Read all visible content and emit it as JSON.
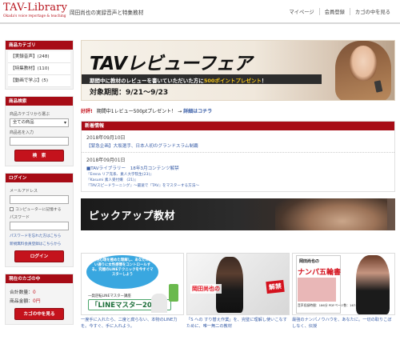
{
  "header": {
    "logo_main": "TAV-Library",
    "logo_sub": "Okada's voice reportage & teaching",
    "tagline": "岡田尚也の実録音声と特集教材",
    "nav": [
      "マイページ",
      "会員登録",
      "カゴの中を見る"
    ]
  },
  "sidebar": {
    "categories": {
      "title": "商品カテゴリ",
      "items": [
        "【実録音声】(248)",
        "【特集教材】(110)",
        "【動画で学ぶ】(5)"
      ]
    },
    "search": {
      "title": "商品検索",
      "category_label": "商品カテゴリから選ぶ",
      "category_value": "全ての商品",
      "name_label": "商品名を入力",
      "name_value": "",
      "button": "検　索"
    },
    "login": {
      "title": "ログイン",
      "email_label": "メールアドレス",
      "email_value": "",
      "remember_label": "コンピューターに記憶する",
      "password_label": "パスワード",
      "password_value": "",
      "forgot_link": "パスワードを忘れた方はこちら",
      "register_link": "新規無料会員登録はこちらから",
      "button": "ログイン"
    },
    "cart": {
      "title": "現在のカゴの中",
      "total_count_label": "合計数量：",
      "total_count_value": "0",
      "subtotal_label": "商品金額：",
      "subtotal_value": "0円",
      "button": "カゴの中を見る"
    }
  },
  "main": {
    "banner": {
      "title": "TAVレビューフェア",
      "strip_text": "期間中に教材のレビューを書いていただいた方に",
      "strip_highlight": "500ポイントプレゼント",
      "strip_tail": "！",
      "date": "対象期間：9/21〜9/23"
    },
    "notice": {
      "tag": "好評!",
      "text": "期間中1レビュー500ptプレゼント！ →",
      "link": "詳細はコチラ"
    },
    "news": {
      "title": "新着情報",
      "items": [
        {
          "date": "2018年09月10日",
          "link": "【緊急企画】大坂選手、日本人初のグランドスラム制覇",
          "subs": []
        },
        {
          "date": "2018年09月01日",
          "link": "■TAVライブラリー　18年3月コンテンツ解禁",
          "subs": [
            "『Erena リア充系、素人大学院生(23)』",
            "『Kasumi 素人受付嬢　(21)』",
            "『TAVスピードラーニング』〜最速で『TAV』をマスターする方法〜"
          ]
        }
      ]
    },
    "pickup": {
      "title": "ピックアップ教材"
    },
    "products": [
      {
        "blob_text": "女性心理を極めた理解し、あなたの思い通りに女性感情をコントロールする。究極のLINEテクニックを今すぐマスターしよう",
        "sub": "一発逆転LINEマスター講座",
        "big": "「LINEマスター2015」",
        "desc": "一度手に入れたら、二度と腐らない、本物のLINE力を。今すぐ、手に入れよう。"
      },
      {
        "title": "岡田尚也の",
        "category": "解禁",
        "desc": "「S への すり替え作業」を、完璧に理解し使いこなすために、唯一無二の教材"
      },
      {
        "author": "岡田尚也の",
        "title": "ナンパ五輪書",
        "dl": "音声収録時間：186分 PDFページ数：167ページ",
        "desc": "最強のナンパノウハウを、あなたに。一切の取りこぼしなく、伝授"
      }
    ]
  }
}
